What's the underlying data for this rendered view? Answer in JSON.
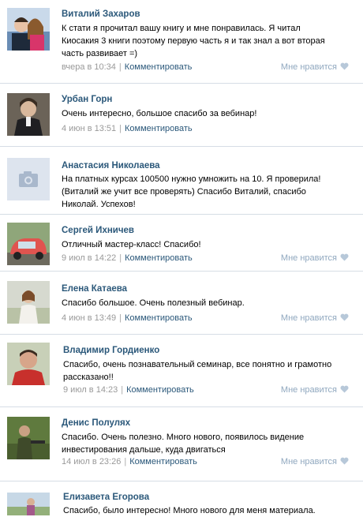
{
  "like_label": "Мне нравится",
  "reply_label": "Комментировать",
  "comments": [
    {
      "author": "Виталий Захаров",
      "lines": [
        "К стати я прочитал вашу книгу и мне понравилась. Я читал",
        "Киосакия 3 книги поэтому первую часть я и так знал а вот вторая",
        "часть развивает =)"
      ],
      "time": "вчера в 10:34"
    },
    {
      "author": "Урбан Горн",
      "lines": [
        "Очень интересно, большое спасибо за вебинар!"
      ],
      "time": "4 июн в 13:51"
    },
    {
      "author": "Анастасия Николаева",
      "lines": [
        "На платных курсах 100500 нужно умножить на 10. Я проверила!",
        "(Виталий же учит все проверять) Спасибо Виталий, спасибо",
        "Николай. Успехов!"
      ],
      "time": ""
    },
    {
      "author": "Сергей Ихничев",
      "lines": [
        "Отличный мастер-класс! Спасибо!"
      ],
      "time": "9 июл в 14:22"
    },
    {
      "author": "Елена Катаева",
      "lines": [
        "Спасибо большое. Очень полезный вебинар."
      ],
      "time": "4 июн в 13:49"
    },
    {
      "author": "Владимир Гордиенко",
      "lines": [
        "Спасибо, очень познавательный семинар, все понятно и грамотно",
        "рассказано!!"
      ],
      "time": "9 июл в 14:23"
    },
    {
      "author": "Денис Полулях",
      "lines": [
        "Спасибо. Очень полезно. Много нового, появилось видение",
        "инвестирования дальше, куда двигаться"
      ],
      "time": "14 июл в 23:26"
    },
    {
      "author": "Елизавета Егорова",
      "lines": [
        "Спасибо, было интересно! Много нового для меня материала."
      ],
      "time": ""
    }
  ]
}
